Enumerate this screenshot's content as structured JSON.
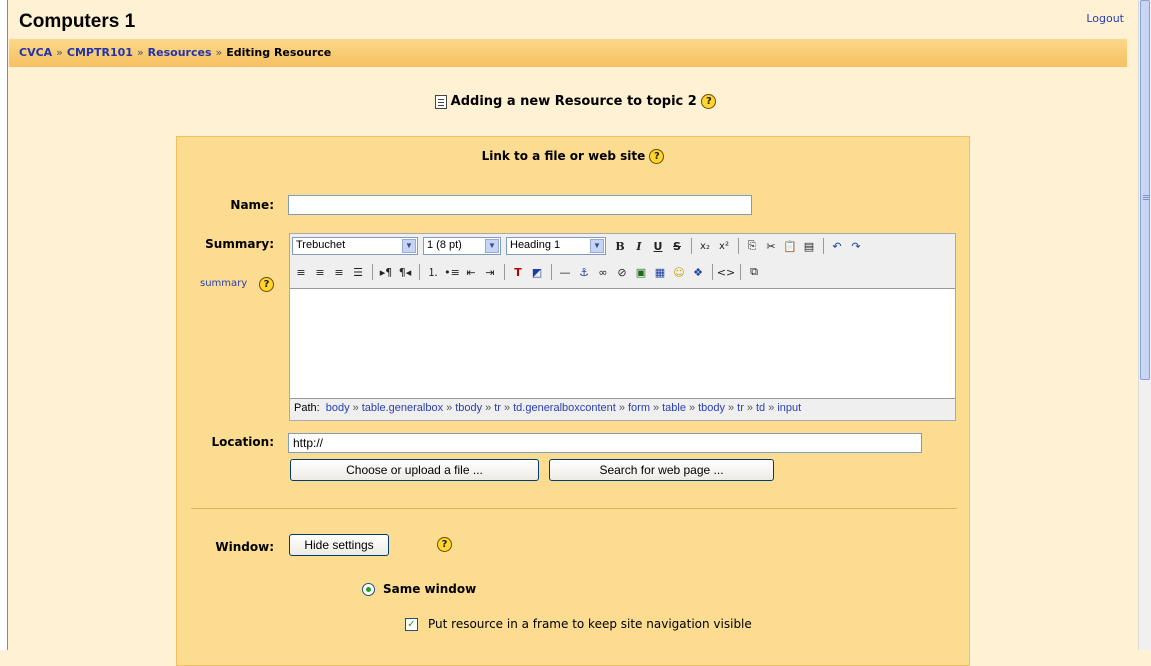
{
  "header": {
    "site_title": "Computers 1",
    "logout_label": "Logout",
    "breadcrumb": [
      "CVCA",
      "CMPTR101",
      "Resources"
    ],
    "breadcrumb_current": "Editing Resource",
    "separator": "»"
  },
  "page": {
    "heading": "Adding a new Resource to topic 2",
    "help_symbol": "?"
  },
  "form": {
    "heading": "Link to a file or web site",
    "name_label": "Name:",
    "name_value": "",
    "summary_label": "Summary:",
    "summary_link": "summary",
    "location_label": "Location:",
    "location_value": "http://",
    "choose_file_button": "Choose or upload a file ...",
    "search_web_button": "Search for web page ...",
    "window_label": "Window:",
    "hide_settings_button": "Hide settings",
    "same_window_label": "Same window",
    "frame_checkbox_label": "Put resource in a frame to keep site navigation visible"
  },
  "editor": {
    "font_family": "Trebuchet",
    "font_size": "1 (8 pt)",
    "heading_format": "Heading 1",
    "path_label": "Path:",
    "path": [
      "body",
      "table.generalbox",
      "tbody",
      "tr",
      "td.generalboxcontent",
      "form",
      "table",
      "tbody",
      "tr",
      "td",
      "input"
    ]
  },
  "colors": {
    "page_background": "#fff1d4",
    "navbar": "#f6c062",
    "form_box": "#fbdc90",
    "link": "#2a3fb0"
  }
}
